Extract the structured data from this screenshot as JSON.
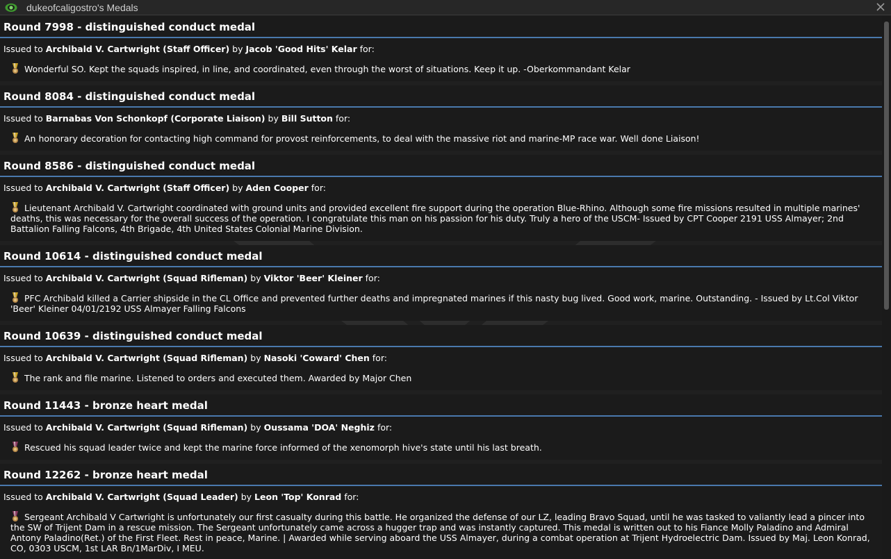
{
  "window": {
    "title": "dukeofcaligostro's Medals",
    "icon": "eye-icon",
    "close_icon": "close-icon"
  },
  "labels": {
    "issued_to": "Issued to",
    "by": "by",
    "for": "for:"
  },
  "colors": {
    "accent_line": "#4a79ad",
    "conduct_ribbon": "#c9a227",
    "heart_ribbon": "#8a3b60"
  },
  "medals": [
    {
      "title": "Round 7998 - distinguished conduct medal",
      "recipient": "Archibald V. Cartwright (Staff Officer)",
      "issuer": "Jacob 'Good Hits' Kelar",
      "icon": "conduct-medal-icon",
      "citation": "Wonderful SO. Kept the squads inspired, in line, and coordinated, even through the worst of situations. Keep it up. -Oberkommandant Kelar"
    },
    {
      "title": "Round 8084 - distinguished conduct medal",
      "recipient": "Barnabas Von Schonkopf (Corporate Liaison)",
      "issuer": "Bill Sutton",
      "icon": "conduct-medal-icon",
      "citation": "An honorary decoration for contacting high command for provost reinforcements, to deal with the massive riot and marine-MP race war. Well done Liaison!"
    },
    {
      "title": "Round 8586 - distinguished conduct medal",
      "recipient": "Archibald V. Cartwright (Staff Officer)",
      "issuer": "Aden Cooper",
      "icon": "conduct-medal-icon",
      "citation": "Lieutenant Archibald V. Cartwright coordinated with ground units and provided excellent fire support during the operation Blue-Rhino. Although some fire missions resulted in multiple marines' deaths, this was necessary for the overall success of the operation. I congratulate this man on his passion for his duty. Truly a hero of the USCM- Issued by CPT Cooper 2191 USS Almayer; 2nd Battalion Falling Falcons, 4th Brigade, 4th United States Colonial Marine Division."
    },
    {
      "title": "Round 10614 - distinguished conduct medal",
      "recipient": "Archibald V. Cartwright (Squad Rifleman)",
      "issuer": "Viktor 'Beer' Kleiner",
      "icon": "conduct-medal-icon",
      "citation": "PFC Archibald killed a Carrier shipside in the CL Office and prevented further deaths and impregnated marines if this nasty bug lived. Good work, marine. Outstanding. - Issued by Lt.Col Viktor 'Beer' Kleiner 04/01/2192 USS Almayer Falling Falcons"
    },
    {
      "title": "Round 10639 - distinguished conduct medal",
      "recipient": "Archibald V. Cartwright (Squad Rifleman)",
      "issuer": "Nasoki 'Coward' Chen",
      "icon": "conduct-medal-icon",
      "citation": "The rank and file marine. Listened to orders and executed them. Awarded by Major Chen"
    },
    {
      "title": "Round 11443 - bronze heart medal",
      "recipient": "Archibald V. Cartwright (Squad Rifleman)",
      "issuer": "Oussama 'DOA' Neghiz",
      "icon": "heart-medal-icon",
      "citation": "Rescued his squad leader twice and kept the marine force informed of the xenomorph hive's state until his last breath."
    },
    {
      "title": "Round 12262 - bronze heart medal",
      "recipient": "Archibald V. Cartwright (Squad Leader)",
      "issuer": "Leon 'Top' Konrad",
      "icon": "heart-medal-icon",
      "citation": "Sergeant Archibald V Cartwright is unfortunately our first casualty during this battle. He organized the defense of our LZ, leading Bravo Squad, until he was tasked to valiantly lead a pincer into the SW of Trijent Dam in a rescue mission. The Sergeant unfortunately came across a hugger trap and was instantly captured. This medal is written out to his Fiance Molly Paladino and Admiral Antony Paladino(Ret.) of the First Fleet. Rest in peace, Marine. | Awarded while serving aboard the USS Almayer, during a combat operation at Trijent Hydroelectric Dam. Issued by Maj. Leon Konrad, CO, 0303 USCM, 1st LAR Bn/1MarDiv, I MEU."
    }
  ]
}
